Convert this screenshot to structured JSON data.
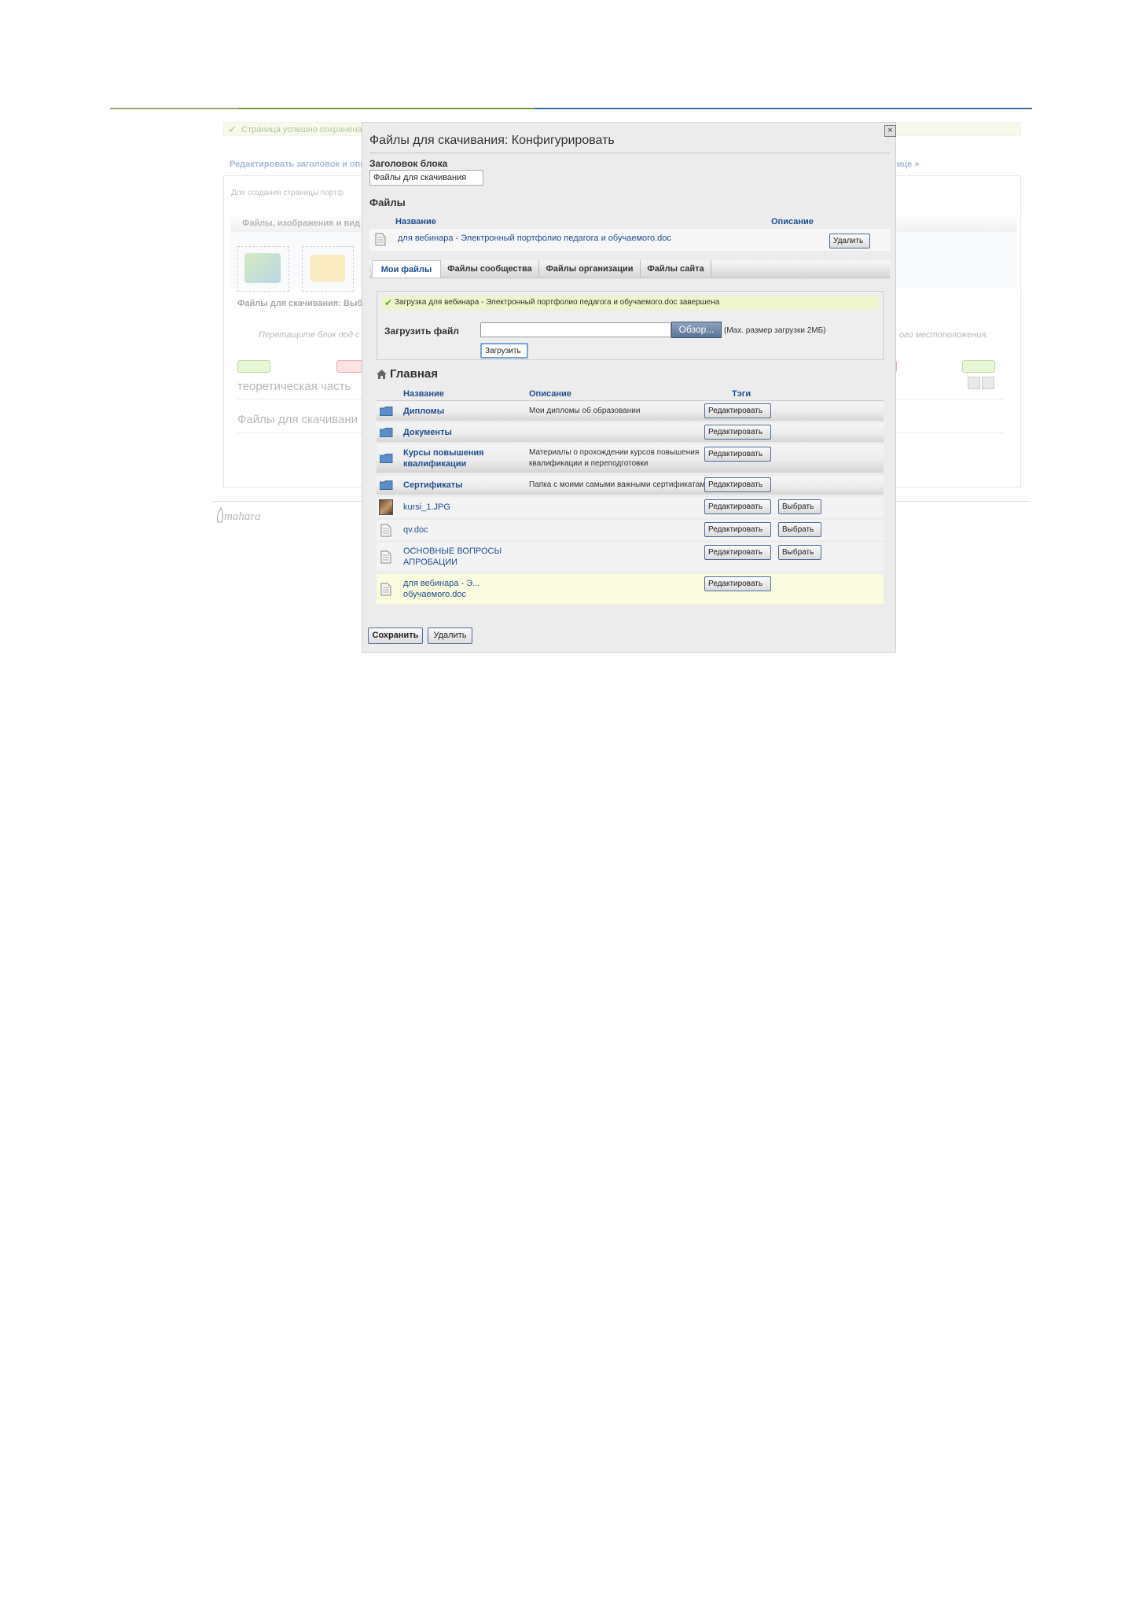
{
  "background_page": {
    "success_message": "Страница успешно сохранена",
    "edit_title_link": "Редактировать заголовок и опи",
    "next_link": "нице »",
    "intro_text": "Для создания страницы портф",
    "category_title": "Файлы, изображения и вид",
    "downloads_label": "Файлы для скачивания: Выб",
    "drag_hint": "Перетащите блок под с",
    "location_hint": "ого местоположения.",
    "section_theory": "теоретическая часть",
    "section_downloads": "Файлы для скачивани"
  },
  "dialog": {
    "title": "Файлы для скачивания: Конфигурировать",
    "close_symbol": "×",
    "block_title_label": "Заголовок блока",
    "block_title_value": "Файлы для скачивания",
    "files_label": "Файлы",
    "selected_headers": {
      "name": "Название",
      "description": "Описание"
    },
    "selected_file": {
      "name": "для вебинара - Электронный портфолио педагога и обучаемого.doc",
      "remove_label": "Удалить"
    },
    "tabs": [
      {
        "label": "Мои файлы",
        "active": true
      },
      {
        "label": "Файлы сообщества",
        "active": false
      },
      {
        "label": "Файлы организации",
        "active": false
      },
      {
        "label": "Файлы сайта",
        "active": false
      }
    ],
    "upload_success": "Загрузка для вебинара - Электронный портфолио педагога и обучаемого.doc завершена",
    "upload_label": "Загрузить файл",
    "browse_label": "Обзор...",
    "max_size": "(Max. размер загрузки 2МБ)",
    "upload_button": "Загрузить",
    "home_label": "Главная",
    "list_headers": {
      "name": "Название",
      "description": "Описание",
      "tags": "Тэги"
    },
    "edit_label": "Редактировать",
    "select_label": "Выбрать",
    "rows": [
      {
        "type": "folder",
        "name": "Дипломы",
        "description": "Мои дипломы об образовании"
      },
      {
        "type": "folder",
        "name": "Документы",
        "description": ""
      },
      {
        "type": "folder",
        "name": "Курсы повышения квалификации",
        "name_lines": [
          "Курсы повышения",
          "квалификации"
        ],
        "description_lines": [
          "Материалы о прохождении курсов повышения",
          "квалификации и переподготовки"
        ]
      },
      {
        "type": "folder",
        "name": "Сертификаты",
        "description": "Папка с моими самыми важными сертификатами"
      },
      {
        "type": "image",
        "name": "kursi_1.JPG",
        "description": ""
      },
      {
        "type": "doc",
        "name": "qv.doc",
        "description": ""
      },
      {
        "type": "doc",
        "name_lines": [
          "ОСНОВНЫЕ ВОПРОСЫ",
          "АПРОБАЦИИ"
        ],
        "description": ""
      },
      {
        "type": "doc",
        "name_lines": [
          "для вебинара - Э...",
          "обучаемого.doc"
        ],
        "description": "",
        "selected": true
      }
    ],
    "save_label": "Сохранить",
    "delete_label": "Удалить"
  },
  "footer": {
    "logo": "mahara"
  }
}
